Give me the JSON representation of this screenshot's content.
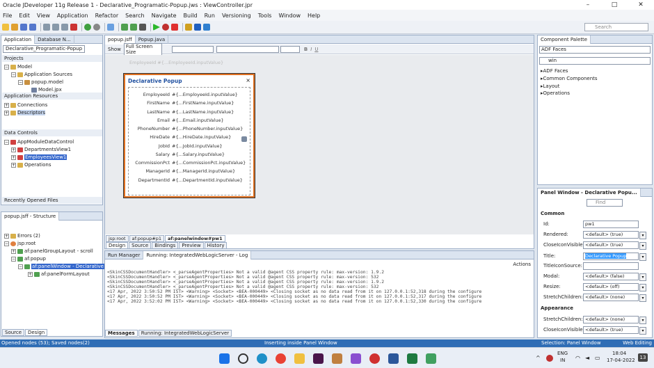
{
  "window": {
    "title": "Oracle JDeveloper 11g Release 1 - Declarative_Programatic-Popup.jws : ViewController.jpr",
    "min": "–",
    "max": "□",
    "close": "✕"
  },
  "menu": [
    "File",
    "Edit",
    "View",
    "Application",
    "Refactor",
    "Search",
    "Navigate",
    "Build",
    "Run",
    "Versioning",
    "Tools",
    "Window",
    "Help"
  ],
  "search": {
    "placeholder": "Search"
  },
  "app_panel": {
    "tabs": [
      "Application",
      "Database N..."
    ],
    "project": "Declarative_Programatic-Popup",
    "projects_label": "Projects",
    "tree": [
      "Model",
      "Application Sources",
      "popup.model",
      "Model.jpx"
    ],
    "app_resources": "Application Resources",
    "app_res_items": [
      "Connections",
      "Descriptors"
    ],
    "data_controls": "Data Controls",
    "dc_items": [
      "AppModuleDataControl",
      "DepartmentsView1",
      "EmployeesView1",
      "Operations"
    ],
    "recent": "Recently Opened Files"
  },
  "structure_panel": {
    "title": "popup.jsff - Structure",
    "items": [
      "Errors (2)",
      "jsp:root",
      "af:panelGroupLayout - scroll",
      "af:popup",
      "af:panelWindow - Declarative Po",
      "af:panelFormLayout"
    ],
    "tabs": [
      "Source",
      "Design"
    ]
  },
  "editor": {
    "tabs": [
      "popup.jsff",
      "Popup.java"
    ],
    "show_label": "Show",
    "size_value": "Full Screen Size",
    "ghost": "EmployeeId  #{...EmployeeId.inputValue}",
    "breadcrumb": [
      "jsp:root",
      "af:popup#p1",
      "af:panelwindow#pw1"
    ],
    "bottom_tabs": [
      "Design",
      "Source",
      "Bindings",
      "Preview",
      "History"
    ],
    "popup": {
      "title": "Declarative Popup",
      "close": "×",
      "fields": [
        {
          "label": "EmployeeId",
          "value": "#{...EmployeeId.inputValue}"
        },
        {
          "label": "FirstName",
          "value": "#{...FirstName.inputValue}"
        },
        {
          "label": "LastName",
          "value": "#{...LastName.inputValue}"
        },
        {
          "label": "Email",
          "value": "#{...Email.inputValue}"
        },
        {
          "label": "PhoneNumber",
          "value": "#{...PhoneNumber.inputValue}"
        },
        {
          "label": "HireDate",
          "value": "#{...HireDate.inputValue}"
        },
        {
          "label": "JobId",
          "value": "#{...JobId.inputValue}"
        },
        {
          "label": "Salary",
          "value": "#{...Salary.inputValue}"
        },
        {
          "label": "CommissionPct",
          "value": "#{...CommissionPct.inputValue}"
        },
        {
          "label": "ManagerId",
          "value": "#{...ManagerId.inputValue}"
        },
        {
          "label": "DepartmentId",
          "value": "#{...DepartmentId.inputValue}"
        }
      ]
    }
  },
  "log": {
    "tabs": [
      "Run Manager",
      "Running: IntegratedWebLogicServer - Log"
    ],
    "actions": "Actions",
    "lines": [
      "<SkinCSSDocumentHandler> <_parseAgentProperties> Not a valid @agent CSS property rule: max-version: 1.9.2",
      "<SkinCSSDocumentHandler> <_parseAgentProperties> Not a valid @agent CSS property rule: max-version: 532",
      "<SkinCSSDocumentHandler> <_parseAgentProperties> Not a valid @agent CSS property rule: max-version: 1.9.2",
      "<SkinCSSDocumentHandler> <_parseAgentProperties> Not a valid @agent CSS property rule: max-version: 532",
      "<17 Apr, 2022 3:50:52 PM IST> <Warning> <Socket> <BEA-000449> <Closing socket as no data read from it on 127.0.0.1:52,318 during the configure",
      "<17 Apr, 2022 3:50:52 PM IST> <Warning> <Socket> <BEA-000449> <Closing socket as no data read from it on 127.0.0.1:52,317 during the configure",
      "<17 Apr, 2022 3:52:02 PM IST> <Warning> <Socket> <BEA-000449> <Closing socket as no data read from it on 127.0.0.1:52,330 during the configure"
    ],
    "bottom_tabs": [
      "Messages",
      "Running: IntegratedWebLogicServer"
    ]
  },
  "palette": {
    "title": "Component Palette",
    "library": "ADF Faces",
    "search_value": "win",
    "items": [
      "ADF Faces",
      "Common Components",
      "Layout",
      "Operations"
    ]
  },
  "inspector": {
    "title": "Panel Window - Declarative Popu...",
    "find": "Find",
    "common": "Common",
    "props": [
      {
        "name": "Id:",
        "value": "pw1"
      },
      {
        "name": "Rendered:",
        "value": "<default> (true)"
      },
      {
        "name": "CloseIconVisible:",
        "value": "<default> (true)"
      },
      {
        "name": "Title:",
        "value": "Declarative Popup"
      },
      {
        "name": "TitleIconSource:",
        "value": ""
      },
      {
        "name": "Modal:",
        "value": "<default> (false)"
      },
      {
        "name": "Resize:",
        "value": "<default> (off)"
      },
      {
        "name": "StretchChildren:",
        "value": "<default> (none)"
      }
    ],
    "appearance": "Appearance",
    "app_props": [
      {
        "name": "StretchChildren:",
        "value": "<default> (none)"
      },
      {
        "name": "CloseIconVisible:",
        "value": "<default> (true)"
      }
    ]
  },
  "status": {
    "left": "Opened nodes (53); Saved nodes(2)",
    "center": "Inserting inside Panel Window",
    "right1": "Selection: Panel Window",
    "right2": "Web Editing"
  },
  "taskbar": {
    "lang1": "ENG",
    "lang2": "IN",
    "time": "18:04",
    "date": "17-04-2022",
    "badge": "13"
  }
}
